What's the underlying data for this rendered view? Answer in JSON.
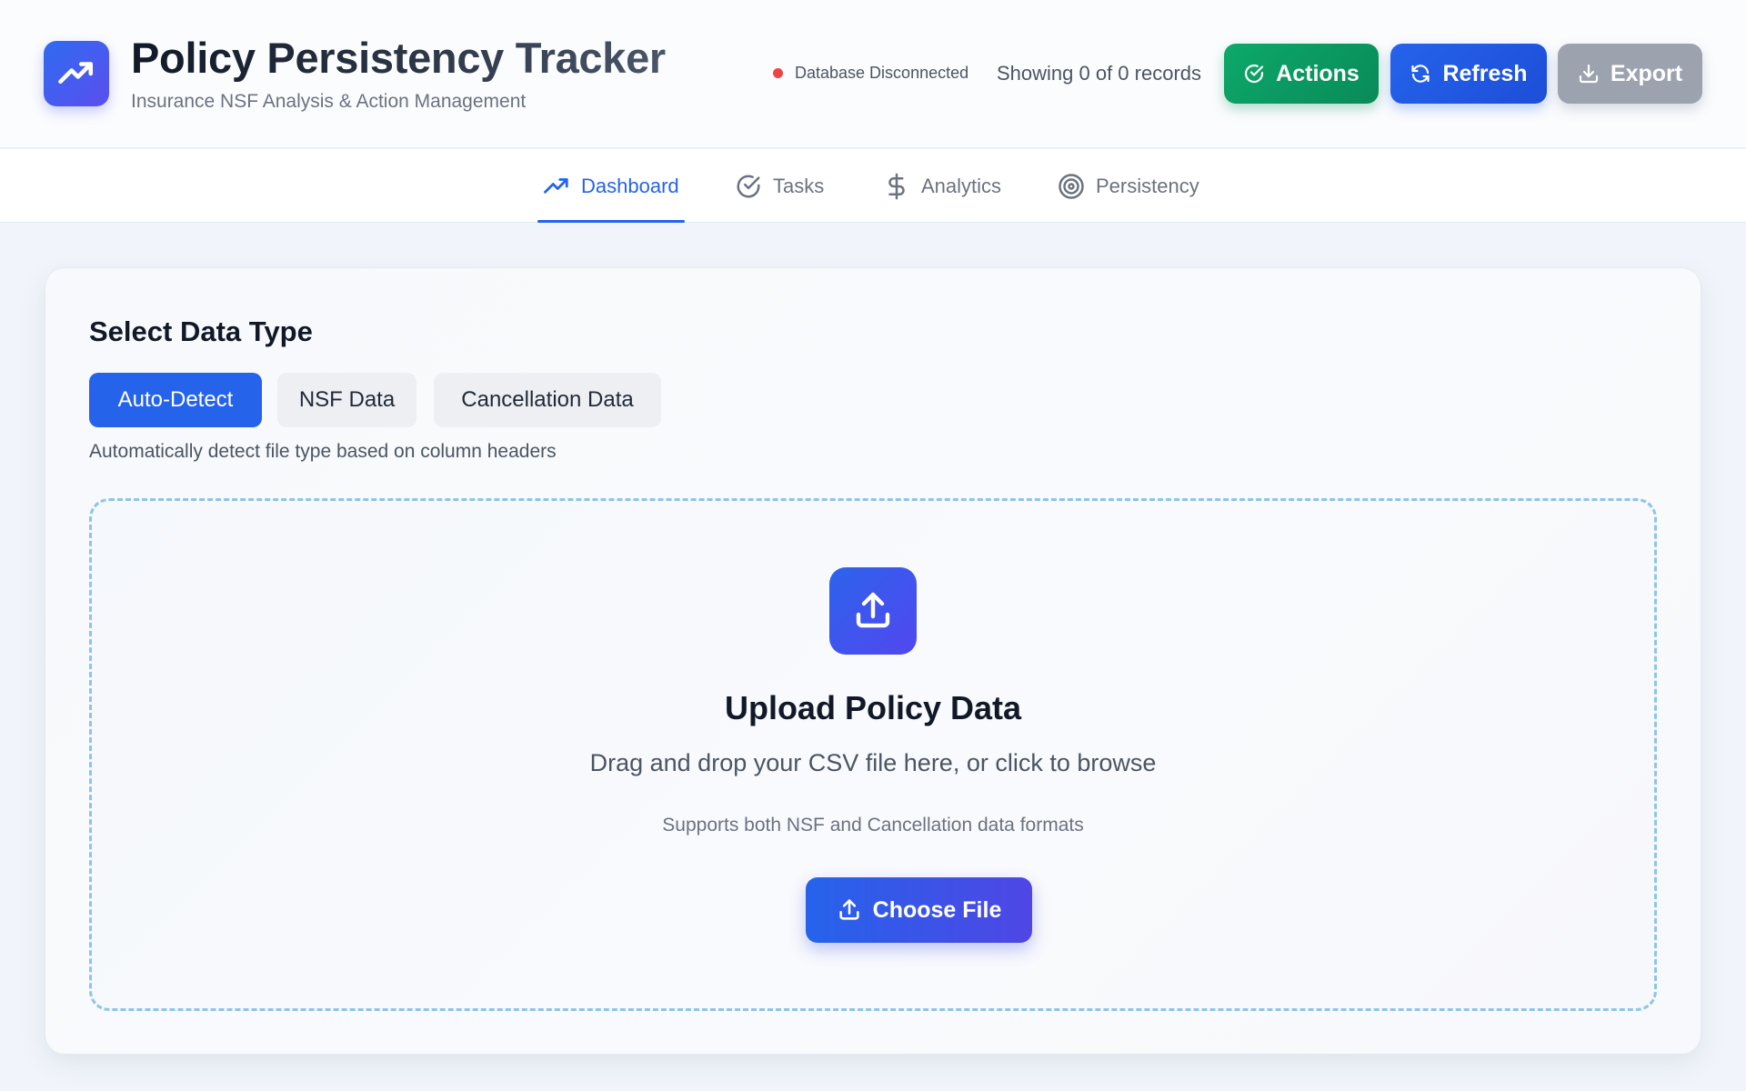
{
  "app": {
    "title": "Policy Persistency Tracker",
    "subtitle": "Insurance NSF Analysis & Action Management",
    "logo_icon": "trending-up-icon",
    "brand_gradient": [
      "#2f6bf0",
      "#5b4ef0"
    ]
  },
  "header": {
    "status": {
      "text": "Database Disconnected",
      "color": "#ef4444"
    },
    "records_text": "Showing 0 of 0 records",
    "buttons": {
      "actions": {
        "label": "Actions",
        "icon": "check-circle-icon",
        "color": "#0ca96a"
      },
      "refresh": {
        "label": "Refresh",
        "icon": "refresh-icon",
        "color": "#2563eb"
      },
      "export": {
        "label": "Export",
        "icon": "download-icon",
        "color": "#9ca3af"
      }
    }
  },
  "tabs": [
    {
      "label": "Dashboard",
      "icon": "trending-up-icon",
      "active": true
    },
    {
      "label": "Tasks",
      "icon": "check-circle-icon",
      "active": false
    },
    {
      "label": "Analytics",
      "icon": "dollar-icon",
      "active": false
    },
    {
      "label": "Persistency",
      "icon": "target-icon",
      "active": false
    }
  ],
  "data_type": {
    "title": "Select Data Type",
    "options": [
      {
        "label": "Auto-Detect",
        "selected": true
      },
      {
        "label": "NSF Data",
        "selected": false
      },
      {
        "label": "Cancellation Data",
        "selected": false
      }
    ],
    "hint": "Automatically detect file type based on column headers"
  },
  "upload": {
    "icon": "upload-icon",
    "title": "Upload Policy Data",
    "description": "Drag and drop your CSV file here, or click to browse",
    "formats": "Supports both NSF and Cancellation data formats",
    "button_label": "Choose File",
    "button_icon": "upload-icon"
  },
  "colors": {
    "accent": "#2563eb",
    "dropzone_border": "#8ec5e6"
  }
}
